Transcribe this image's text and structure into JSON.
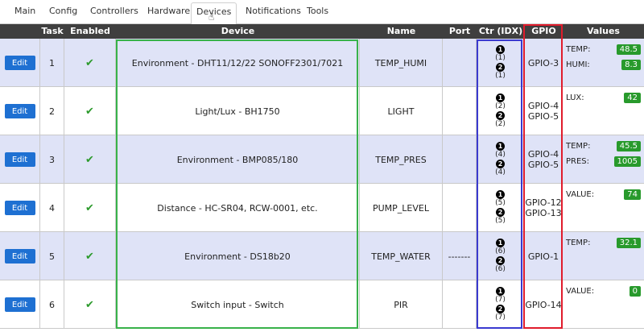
{
  "tabs": [
    {
      "label": "Main"
    },
    {
      "label": "Config"
    },
    {
      "label": "Controllers"
    },
    {
      "label": "Hardware"
    },
    {
      "label": "Devices"
    },
    {
      "label": "Notifications"
    },
    {
      "label": "Tools"
    }
  ],
  "active_tab": "Devices",
  "table": {
    "headers": {
      "task": "Task",
      "enabled": "Enabled",
      "device": "Device",
      "name": "Name",
      "port": "Port",
      "ctr": "Ctr (IDX)",
      "gpio": "GPIO",
      "values": "Values"
    },
    "edit_label": "Edit",
    "enabled_glyph": "✔",
    "rows": [
      {
        "task": "1",
        "device": "Environment - DHT11/12/22 SONOFF2301/7021",
        "name": "TEMP_HUMI",
        "port": "",
        "ctr": {
          "b1": "1",
          "i1": "(1)",
          "b2": "2",
          "i2": "(1)"
        },
        "gpio": [
          "GPIO-3",
          ""
        ],
        "values": [
          {
            "label": "TEMP:",
            "value": "48.5"
          },
          {
            "label": "HUMI:",
            "value": "8.3"
          }
        ]
      },
      {
        "task": "2",
        "device": "Light/Lux - BH1750",
        "name": "LIGHT",
        "port": "",
        "ctr": {
          "b1": "1",
          "i1": "(2)",
          "b2": "2",
          "i2": "(2)"
        },
        "gpio": [
          "GPIO-4",
          "GPIO-5"
        ],
        "values": [
          {
            "label": "LUX:",
            "value": "42"
          }
        ]
      },
      {
        "task": "3",
        "device": "Environment - BMP085/180",
        "name": "TEMP_PRES",
        "port": "",
        "ctr": {
          "b1": "1",
          "i1": "(4)",
          "b2": "2",
          "i2": "(4)"
        },
        "gpio": [
          "GPIO-4",
          "GPIO-5"
        ],
        "values": [
          {
            "label": "TEMP:",
            "value": "45.5"
          },
          {
            "label": "PRES:",
            "value": "1005"
          }
        ]
      },
      {
        "task": "4",
        "device": "Distance - HC-SR04, RCW-0001, etc.",
        "name": "PUMP_LEVEL",
        "port": "",
        "ctr": {
          "b1": "1",
          "i1": "(5)",
          "b2": "2",
          "i2": "(5)"
        },
        "gpio": [
          "GPIO-12",
          "GPIO-13"
        ],
        "values": [
          {
            "label": "VALUE:",
            "value": "74"
          }
        ]
      },
      {
        "task": "5",
        "device": "Environment - DS18b20",
        "name": "TEMP_WATER",
        "port": "-------",
        "ctr": {
          "b1": "1",
          "i1": "(6)",
          "b2": "2",
          "i2": "(6)"
        },
        "gpio": [
          "GPIO-1",
          ""
        ],
        "values": [
          {
            "label": "TEMP:",
            "value": "32.1"
          }
        ]
      },
      {
        "task": "6",
        "device": "Switch input - Switch",
        "name": "PIR",
        "port": "",
        "ctr": {
          "b1": "1",
          "i1": "(7)",
          "b2": "2",
          "i2": "(7)"
        },
        "gpio": [
          "GPIO-14",
          ""
        ],
        "values": [
          {
            "label": "VALUE:",
            "value": "0"
          }
        ]
      }
    ]
  },
  "colors": {
    "header_bg": "#3f3f3f",
    "row_alt_bg": "#dfe3f7",
    "edit_button": "#1e70d2",
    "value_badge": "#289a2c",
    "highlight_device": "#38b24a",
    "highlight_ctr": "#3a3ad0",
    "highlight_gpio": "#e01c2c"
  },
  "icons": {
    "enabled": "check-icon",
    "cursor": "mouse-pointer-icon"
  }
}
